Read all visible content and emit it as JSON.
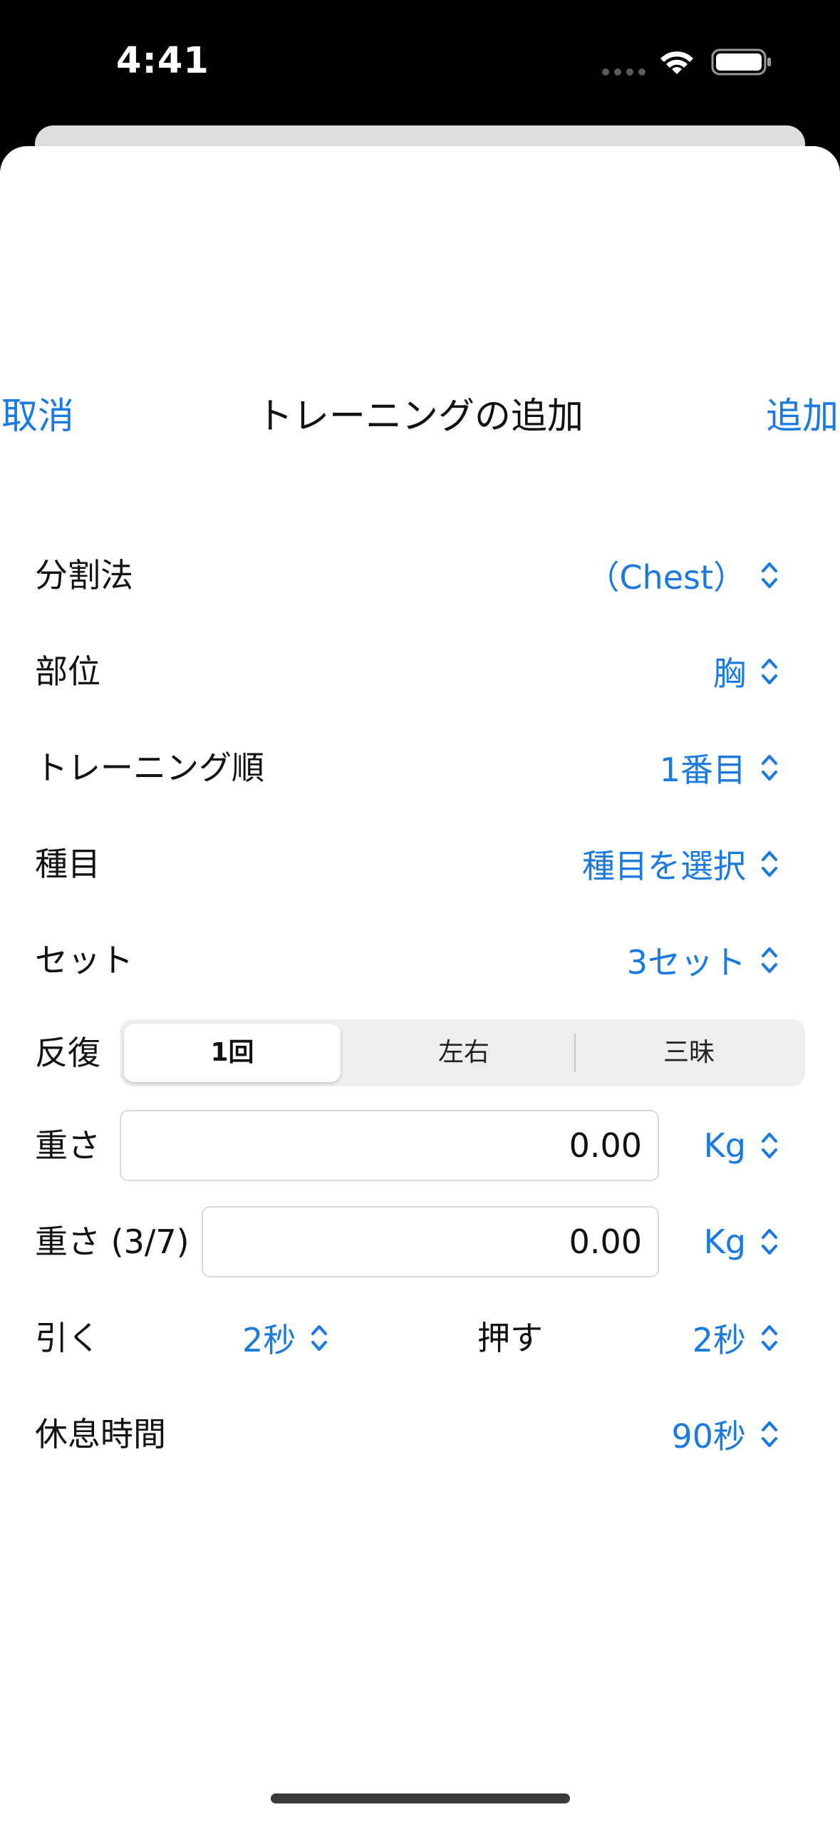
{
  "status_bar": {
    "time": "4:41"
  },
  "nav": {
    "cancel_label": "取消",
    "title": "トレーニングの追加",
    "add_label": "追加"
  },
  "form": {
    "split": {
      "label": "分割法",
      "value": "（Chest）"
    },
    "part": {
      "label": "部位",
      "value": "胸"
    },
    "order": {
      "label": "トレーニング順",
      "value": "1番目"
    },
    "exercise": {
      "label": "種目",
      "value": "種目を選択"
    },
    "sets": {
      "label": "セット",
      "value": "3セット"
    },
    "reps": {
      "label": "反復",
      "segments": [
        "1回",
        "左右",
        "三昧"
      ],
      "selected": "1回"
    },
    "weight": {
      "label": "重さ",
      "value": "0.00",
      "unit": "Kg"
    },
    "weight_37": {
      "label": "重さ (3/7)",
      "value": "0.00",
      "unit": "Kg"
    },
    "pull": {
      "label": "引く",
      "value": "2秒"
    },
    "push": {
      "label": "押す",
      "value": "2秒"
    },
    "rest": {
      "label": "休息時間",
      "value": "90秒"
    }
  },
  "colors": {
    "accent": "#1a7ae0",
    "background": "#ffffff",
    "status_bar": "#000000"
  }
}
